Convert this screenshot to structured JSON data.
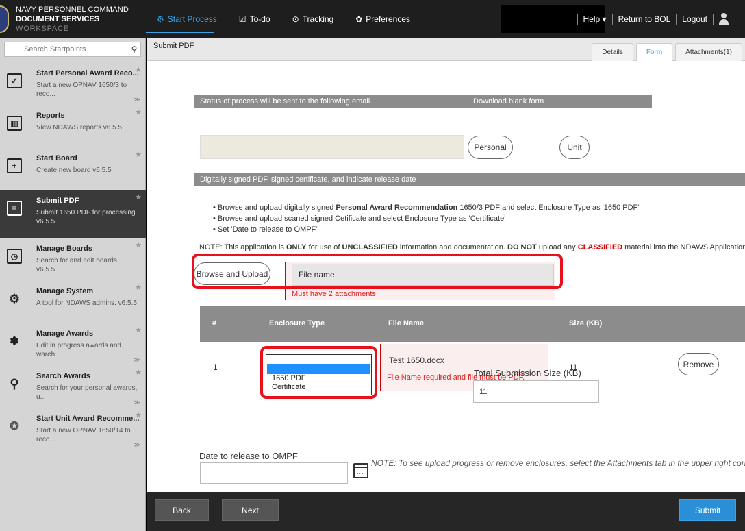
{
  "header": {
    "org_line1": "NAVY PERSONNEL COMMAND",
    "org_line2_bold": "DOCUMENT SERVICES",
    "org_line2_light": "WORKSPACE",
    "nav": [
      {
        "label": "Start Process",
        "icon": "gear-icon"
      },
      {
        "label": "To-do",
        "icon": "checkbox-icon"
      },
      {
        "label": "Tracking",
        "icon": "target-icon"
      },
      {
        "label": "Preferences",
        "icon": "gear-icon"
      }
    ],
    "help": "Help ▾",
    "return": "Return to BOL",
    "logout": "Logout"
  },
  "sidebar": {
    "search_placeholder": "Search Startpoints",
    "items": [
      {
        "title": "Start Personal Award Reco...",
        "desc": "Start a new OPNAV 1650/3 to reco...",
        "icon": "checkmark-icon"
      },
      {
        "title": "Reports",
        "desc": "View NDAWS reports v6.5.5",
        "icon": "report-icon"
      },
      {
        "title": "Start Board",
        "desc": "Create new board v6.5.5",
        "icon": "clipboard-add-icon"
      },
      {
        "title": "Submit PDF",
        "desc": "Submit 1650 PDF for processing v6.5.5",
        "icon": "pdf-icon"
      },
      {
        "title": "Manage Boards",
        "desc": "Search for and edit boards. v6.5.5",
        "icon": "clipboard-clock-icon"
      },
      {
        "title": "Manage System",
        "desc": "A tool for NDAWS admins. v6.5.5",
        "icon": "gear-icon"
      },
      {
        "title": "Manage Awards",
        "desc": "Edit in progress awards and wareh...",
        "icon": "people-gear-icon"
      },
      {
        "title": "Search Awards",
        "desc": "Search for your personal awards, u...",
        "icon": "magnifier-icon"
      },
      {
        "title": "Start Unit Award Recomme...",
        "desc": "Start a new OPNAV 1650/14 to reco...",
        "icon": "medal-icon"
      }
    ]
  },
  "main": {
    "subheader_title": "Submit PDF",
    "tabs": [
      "Details",
      "Form",
      "Attachments(1)"
    ],
    "status_bar_text": "Status of process will be sent to the following email",
    "download_bar_text": "Download blank form",
    "personal_btn": "Personal",
    "unit_btn": "Unit",
    "section_bar": "Digitally signed PDF, signed certificate, and indicate release date",
    "bullet1_pre": "Browse and upload digitally signed ",
    "bullet1_bold": "Personal Award Recommendation",
    "bullet1_post": " 1650/3 PDF and select Enclosure Type as '1650 PDF'",
    "bullet2": "Browse and upload scaned signed Cetificate and select Enclosure Type as 'Certificate'",
    "bullet3": "Set 'Date to release to OMPF'",
    "note_pre": "NOTE: This application is ",
    "note_only": "ONLY",
    "note_mid1": " for use of ",
    "note_unclass": "UNCLASSIFIED",
    "note_mid2": " information and documentation.  ",
    "note_donot": "DO NOT",
    "note_mid3": " upload any ",
    "note_class": "CLASSIFIED",
    "note_post": " material into the NDAWS Application.",
    "browse_btn": "Browse and Upload",
    "file_name_placeholder": "File name",
    "attach_error": "Must have 2 attachments",
    "table": {
      "headers": [
        "#",
        "Enclosure Type",
        "File Name",
        "Size (KB)"
      ],
      "row": {
        "num": "1",
        "options": [
          "1650 PDF",
          "Certificate"
        ],
        "file_name": "Test 1650.docx",
        "file_error": "File Name required and file must be PDF.",
        "size": "11",
        "remove": "Remove"
      }
    },
    "total_label": "Total Submission Size (KB)",
    "total_value": "11",
    "note2": "NOTE: To see upload progress or remove enclosures, select the Attachments tab in the upper right corner.",
    "release_label": "Date to release to OMPF",
    "release_value": ""
  },
  "footer": {
    "back": "Back",
    "next": "Next",
    "submit": "Submit"
  },
  "colors": {
    "accent": "#3aa3e3",
    "error": "#e02020",
    "highlight": "#e8101a",
    "bar_gray": "#8c8c8c"
  }
}
